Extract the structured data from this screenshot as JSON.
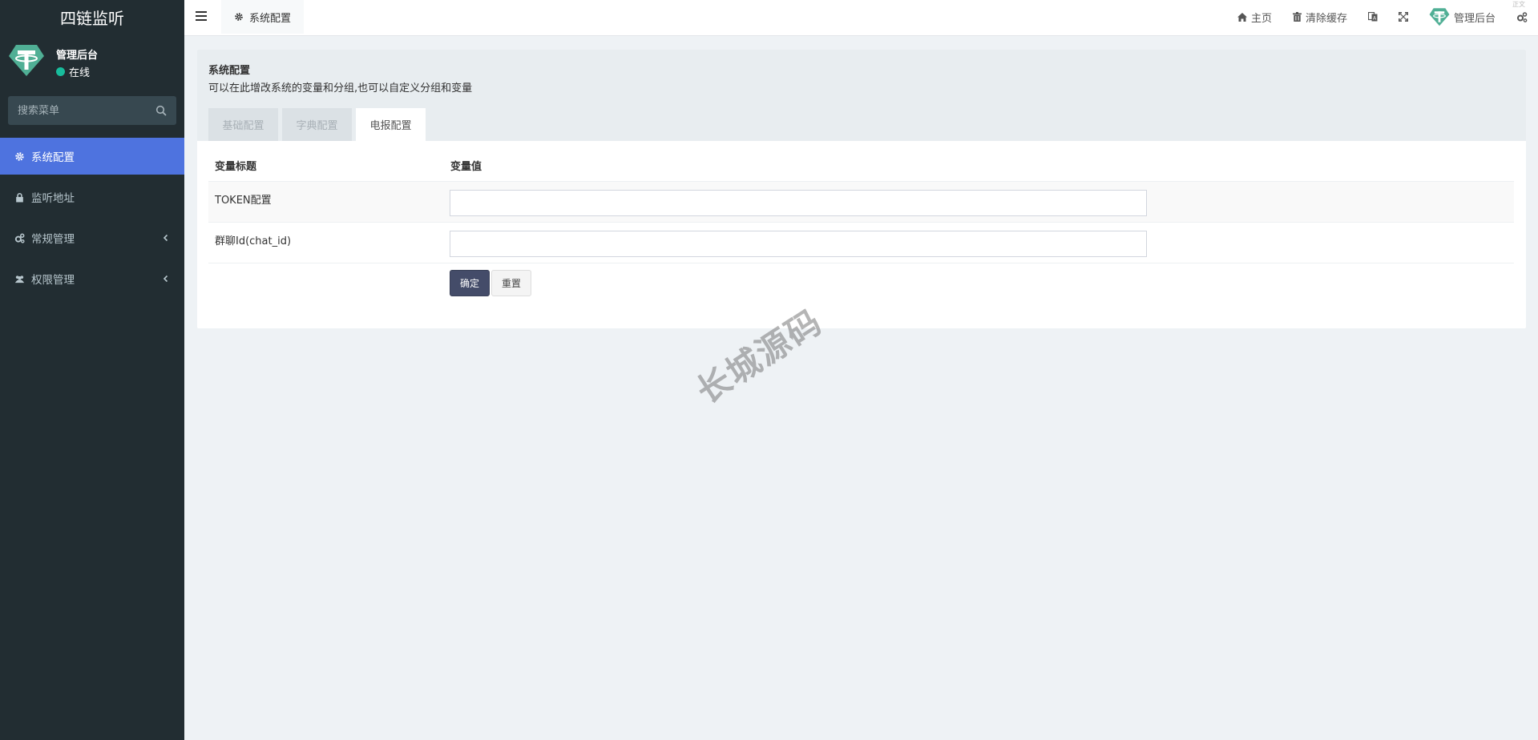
{
  "sidebar": {
    "brand": "四链监听",
    "user": {
      "name": "管理后台",
      "status": "在线"
    },
    "search_placeholder": "搜索菜单",
    "items": [
      {
        "label": "系统配置",
        "icon": "gear-icon",
        "active": true
      },
      {
        "label": "监听地址",
        "icon": "lock-icon"
      },
      {
        "label": "常规管理",
        "icon": "cogs-icon",
        "has_children": true
      },
      {
        "label": "权限管理",
        "icon": "users-icon",
        "has_children": true
      }
    ]
  },
  "header": {
    "tab_label": "系统配置",
    "home_label": "主页",
    "clear_cache_label": "清除缓存",
    "admin_label": "管理后台",
    "corner_text": "正文"
  },
  "panel": {
    "title": "系统配置",
    "description": "可以在此增改系统的变量和分组,也可以自定义分组和变量",
    "tabs": [
      "基础配置",
      "字典配置",
      "电报配置"
    ],
    "active_tab": 2
  },
  "table": {
    "col_title": "变量标题",
    "col_value": "变量值",
    "rows": [
      {
        "label": "TOKEN配置",
        "value": ""
      },
      {
        "label": "群聊Id(chat_id)",
        "value": ""
      }
    ],
    "submit_label": "确定",
    "reset_label": "重置"
  },
  "watermark": "长城源码",
  "colors": {
    "sidebar_bg": "#222d32",
    "active_item": "#4e73df",
    "primary_button": "#444c69",
    "online": "#18bc9c"
  }
}
